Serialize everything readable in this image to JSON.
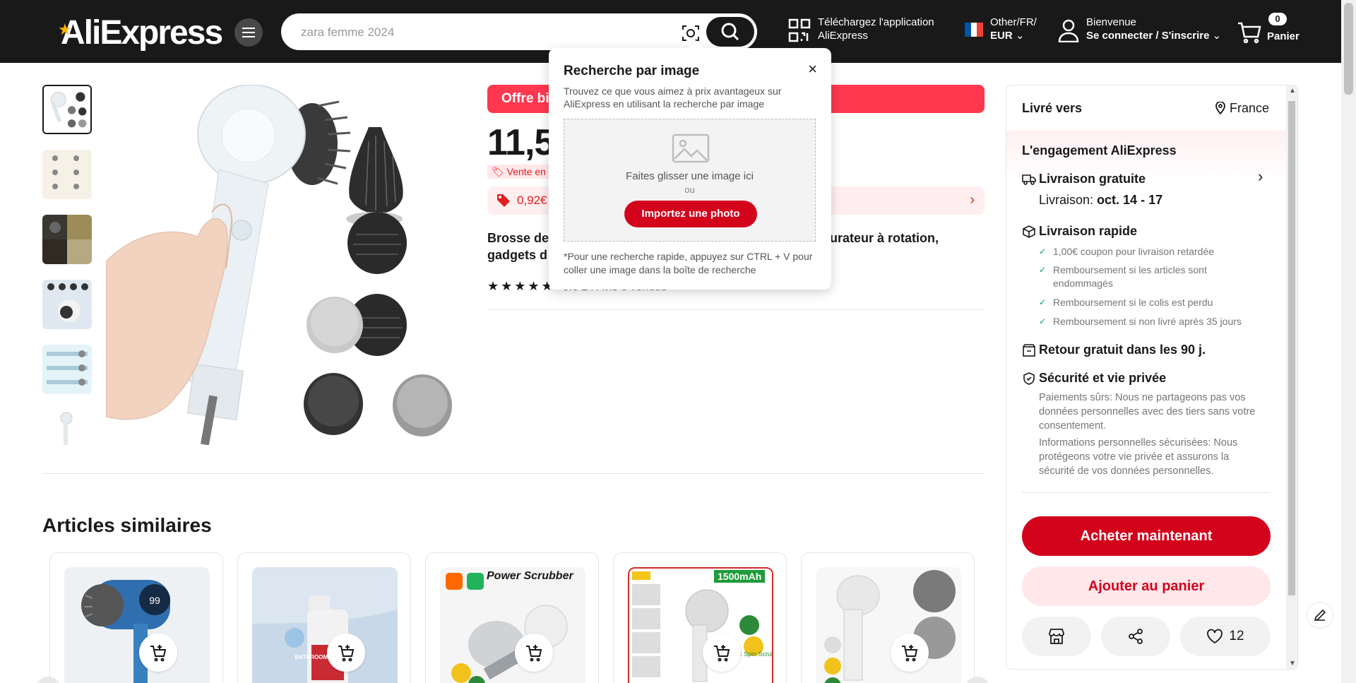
{
  "header": {
    "logo": "AliExpress",
    "search_placeholder": "zara femme 2024",
    "app_line1": "Téléchargez l'application",
    "app_line2": "AliExpress",
    "locale_line1": "Other/FR/",
    "locale_line2": "EUR",
    "welcome": "Bienvenue",
    "signin": "Se connecter / S'inscrire",
    "cart_count": "0",
    "cart_label": "Panier"
  },
  "product": {
    "offer_banner": "Offre bi",
    "price": "11,5",
    "sale_tag": "Vente en g",
    "coupon_text": "0,92€",
    "title_left": "Brosse de",
    "title_right": "purateur à rotation,",
    "title_line2": "gadgets d",
    "rating_text": "5.0   24 Avis   3 vendus"
  },
  "popup": {
    "title": "Recherche par image",
    "close": "×",
    "description": "Trouvez ce que vous aimez à prix avantageux sur AliExpress en utilisant la recherche par image",
    "drop_text": "Faites glisser une image ici",
    "or_text": "ou",
    "upload_label": "Importez une photo",
    "hint": "*Pour une recherche rapide, appuyez sur CTRL + V pour coller une image dans la boîte de recherche"
  },
  "panel": {
    "ship_to": "Livré vers",
    "country": "France",
    "commitment": "L'engagement AliExpress",
    "free_shipping": "Livraison gratuite",
    "delivery_label": "Livraison: ",
    "delivery_date": "oct. 14 - 17",
    "fast_delivery": "Livraison rapide",
    "guarantees": [
      "1,00€ coupon pour livraison retardée",
      "Remboursement si les articles sont endommagés",
      "Remboursement si le colis est perdu",
      "Remboursement si non livré après 35 jours"
    ],
    "free_return": "Retour gratuit dans les 90 j.",
    "security": "Sécurité et vie privée",
    "security_text1": "Paiements sûrs: Nous ne partageons pas vos données personnelles avec des tiers sans votre consentement.",
    "security_text2": "Informations personnelles sécurisées: Nous protégeons votre vie privée et assurons la sécurité de vos données personnelles.",
    "buy_now": "Acheter maintenant",
    "add_to_cart": "Ajouter au panier",
    "wishlist_count": "12"
  },
  "similar": {
    "title": "Articles similaires",
    "card3_label": "Power Scrubber",
    "card4_badge": "1500mAh",
    "card4_sub": "Electric Spin Scrubber",
    "card1_display": "99",
    "card2_label": "BATHROOM DESCALER"
  },
  "colors": {
    "accent_red": "#d3031c",
    "banner_red": "#fd384f",
    "header_bg": "#191919"
  }
}
